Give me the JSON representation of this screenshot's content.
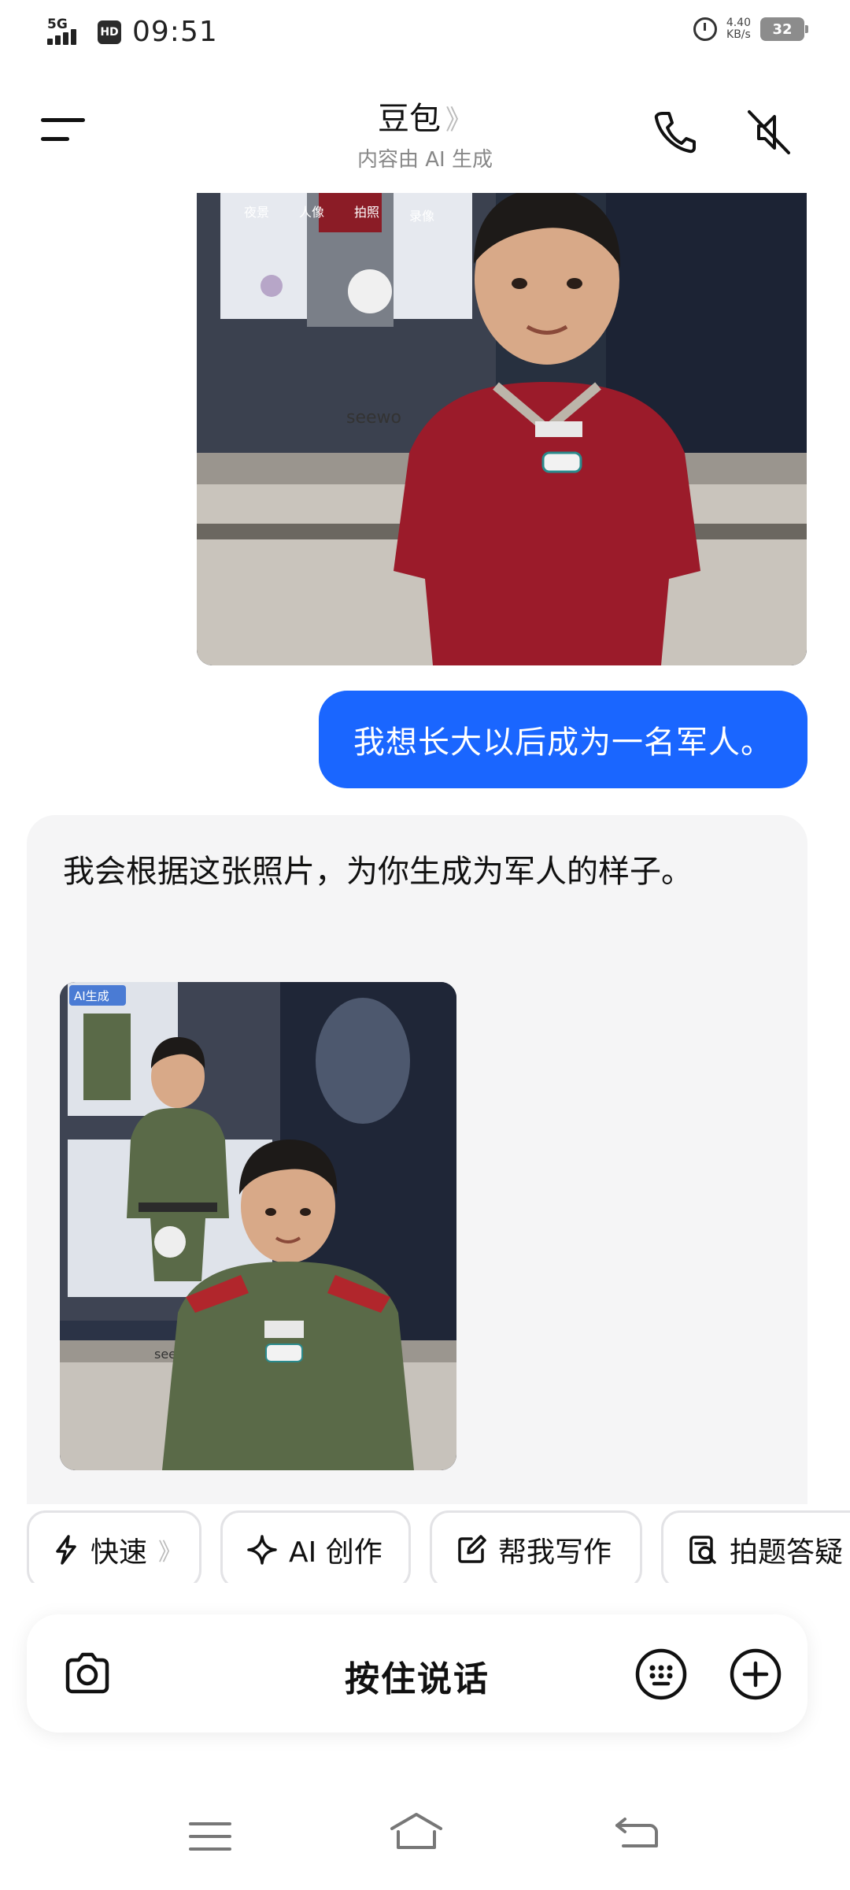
{
  "status_bar": {
    "network": "5G",
    "hd": "HD",
    "time": "09:51",
    "speed_value": "4.40",
    "speed_unit": "KB/s",
    "battery": "32"
  },
  "header": {
    "title": "豆包",
    "title_chevron": "》",
    "subtitle": "内容由 AI 生成",
    "icons": [
      "menu-icon",
      "phone-icon",
      "speaker-mute-icon"
    ]
  },
  "chat": {
    "user_message": "我想长大以后成为一名军人。",
    "ai_message": "我会根据这张照片，为你生成为军人的样子。",
    "ai_image_badge": "AI生成",
    "photo_screen_tabs": [
      "夜景",
      "人像",
      "拍照",
      "录像"
    ],
    "photo_brand": "seewo"
  },
  "quick_actions": [
    {
      "label": "快速",
      "icon": "lightning-icon",
      "chevron": "》"
    },
    {
      "label": "AI 创作",
      "icon": "sparkle-icon"
    },
    {
      "label": "帮我写作",
      "icon": "edit-icon"
    },
    {
      "label": "拍题答疑",
      "icon": "scan-question-icon"
    }
  ],
  "input_bar": {
    "voice_label": "按住说话",
    "icons": [
      "camera-icon",
      "emoji-keyboard-icon",
      "plus-icon"
    ]
  },
  "nav_bar": {
    "icons": [
      "nav-menu-icon",
      "nav-home-icon",
      "nav-back-icon"
    ]
  },
  "colors": {
    "accent_blue": "#1a66ff",
    "ai_card_bg": "#f5f5f6",
    "uniform_red": "#9b1b2a",
    "camo_green": "#5a6a48"
  }
}
